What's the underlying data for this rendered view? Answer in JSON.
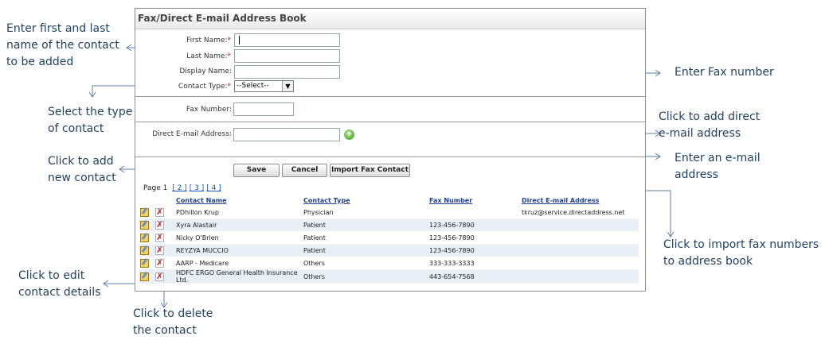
{
  "annotations": {
    "enter_name": "Enter first and last name of the contact to be added",
    "select_type": "Select the type of contact",
    "add_contact": "Click to add new contact",
    "edit_contact": "Click to edit contact details",
    "delete_contact": "Click to delete the contact",
    "enter_fax": "Enter Fax number",
    "add_email": "Click to add direct e-mail address",
    "enter_email": "Enter an e-mail address",
    "import_fax": "Click to import fax numbers to address book"
  },
  "panel": {
    "title": "Fax/Direct E-mail Address Book"
  },
  "form": {
    "first_name_label": "First Name:",
    "last_name_label": "Last Name:",
    "display_name_label": "Display Name:",
    "contact_type_label": "Contact Type:",
    "contact_type_value": "--Select--",
    "fax_label": "Fax Number:",
    "email_label": "Direct E-mail Address:",
    "required_mark": "*"
  },
  "buttons": {
    "save": "Save",
    "cancel": "Cancel",
    "import": "Import Fax Contact"
  },
  "pager": {
    "label": "Page 1",
    "pages": [
      "[ 2 ]",
      "[ 3 ]",
      "[ 4 ]"
    ]
  },
  "table": {
    "headers": [
      "Contact Name",
      "Contact Type",
      "Fax Number",
      "Direct E-mail Address"
    ],
    "rows": [
      {
        "name": "PDhillon Krup",
        "type": "Physician",
        "fax": "",
        "email": "tkruz@service.directaddress.net"
      },
      {
        "name": "Xyra Alastair",
        "type": "Patient",
        "fax": "123-456-7890",
        "email": ""
      },
      {
        "name": "Nicky O'Brien",
        "type": "Patient",
        "fax": "123-456-7890",
        "email": ""
      },
      {
        "name": "REYZYA MUCCIO",
        "type": "Patient",
        "fax": "123-456-7890",
        "email": ""
      },
      {
        "name": "AARP - Medicare",
        "type": "Others",
        "fax": "333-333-3333",
        "email": ""
      },
      {
        "name": "HDFC ERGO General Health Insurance Ltd.",
        "type": "Others",
        "fax": "443-654-7568",
        "email": ""
      }
    ]
  }
}
